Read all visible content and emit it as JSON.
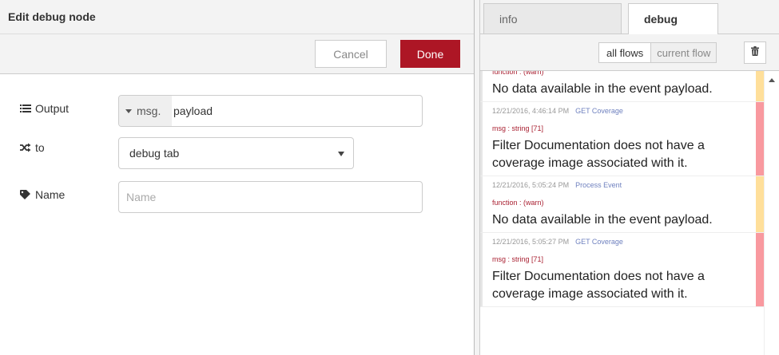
{
  "edit": {
    "title": "Edit debug node",
    "cancel_label": "Cancel",
    "done_label": "Done",
    "output_label": "Output",
    "output_prefix": "msg.",
    "output_value": "payload",
    "to_label": "to",
    "to_value": "debug tab",
    "name_label": "Name",
    "name_placeholder": "Name"
  },
  "sidebar": {
    "tab_info": "info",
    "tab_debug": "debug",
    "filter_all": "all flows",
    "filter_current": "current flow"
  },
  "messages": [
    {
      "level": "warn",
      "timestamp": "",
      "node": "",
      "topic": "function : (warn)",
      "payload": "No data available in the event payload."
    },
    {
      "level": "error",
      "timestamp": "12/21/2016, 4:46:14 PM",
      "node": "GET Coverage",
      "topic": "msg : string [71]",
      "payload": "Filter Documentation does not have a coverage image associated with it."
    },
    {
      "level": "warn",
      "timestamp": "12/21/2016, 5:05:24 PM",
      "node": "Process Event",
      "topic": "function : (warn)",
      "payload": "No data available in the event payload."
    },
    {
      "level": "error",
      "timestamp": "12/21/2016, 5:05:27 PM",
      "node": "GET Coverage",
      "topic": "msg : string [71]",
      "payload": "Filter Documentation does not have a coverage image associated with it."
    }
  ],
  "colors": {
    "done": "#ad1625",
    "warn": "#ffdf9a",
    "error": "#f9999f"
  }
}
